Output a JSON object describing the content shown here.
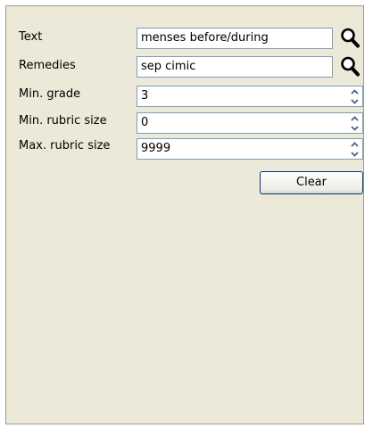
{
  "form": {
    "text_label": "Text",
    "text_value": "menses before/during",
    "remedies_label": "Remedies",
    "remedies_value": "sep cimic",
    "min_grade_label": "Min. grade",
    "min_grade_value": "3",
    "min_rubric_label": "Min. rubric size",
    "min_rubric_value": "0",
    "max_rubric_label": "Max. rubric size",
    "max_rubric_value": "9999",
    "clear_label": "Clear"
  },
  "icons": {
    "search": "search-icon",
    "spin_up": "chevron-up-icon",
    "spin_down": "chevron-down-icon"
  },
  "colors": {
    "panel_bg": "#ece9d8",
    "field_border": "#7f9db9",
    "spinner_arrow": "#4d6185"
  }
}
